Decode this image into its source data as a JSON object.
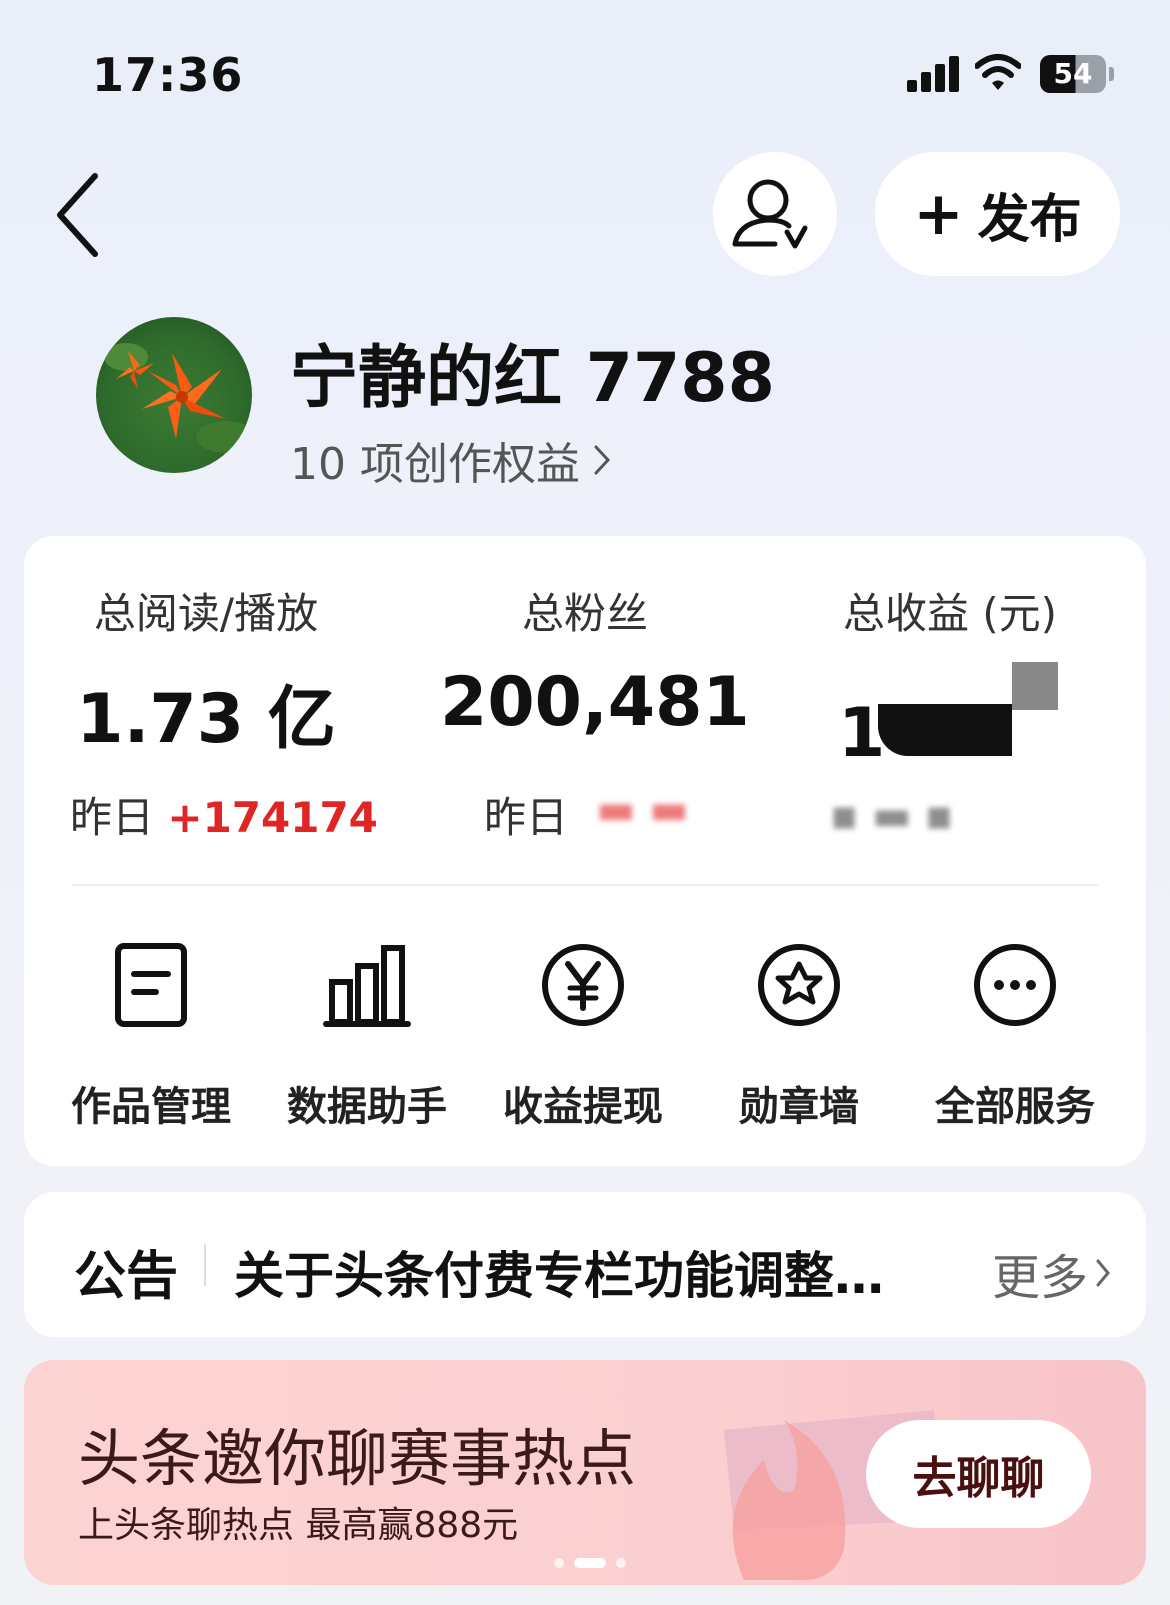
{
  "status_bar": {
    "time": "17:36",
    "battery": "54"
  },
  "header": {
    "publish_label": "发布"
  },
  "profile": {
    "username": "宁静的红 7788",
    "rights_text": "10 项创作权益"
  },
  "stats": [
    {
      "label": "总阅读/播放",
      "value": "1.73 亿",
      "sub_prefix": "昨日",
      "sub_value": "+174174"
    },
    {
      "label": "总粉丝",
      "value": "200,481",
      "sub_prefix": "昨日"
    },
    {
      "label": "总收益 (元)",
      "value": "1"
    }
  ],
  "services": [
    {
      "label": "作品管理",
      "icon": "document-icon"
    },
    {
      "label": "数据助手",
      "icon": "bar-chart-icon"
    },
    {
      "label": "收益提现",
      "icon": "yuan-coin-icon"
    },
    {
      "label": "勋章墙",
      "icon": "medal-icon"
    },
    {
      "label": "全部服务",
      "icon": "more-dots-icon"
    }
  ],
  "notice": {
    "title": "公告",
    "text": "关于头条付费专栏功能调整…",
    "more": "更多"
  },
  "banner": {
    "title": "头条邀你聊赛事热点",
    "subtitle": "上头条聊热点 最高赢888元",
    "button": "去聊聊"
  },
  "colors": {
    "increase": "#e02525",
    "banner_bg": "#fcd3d3"
  }
}
